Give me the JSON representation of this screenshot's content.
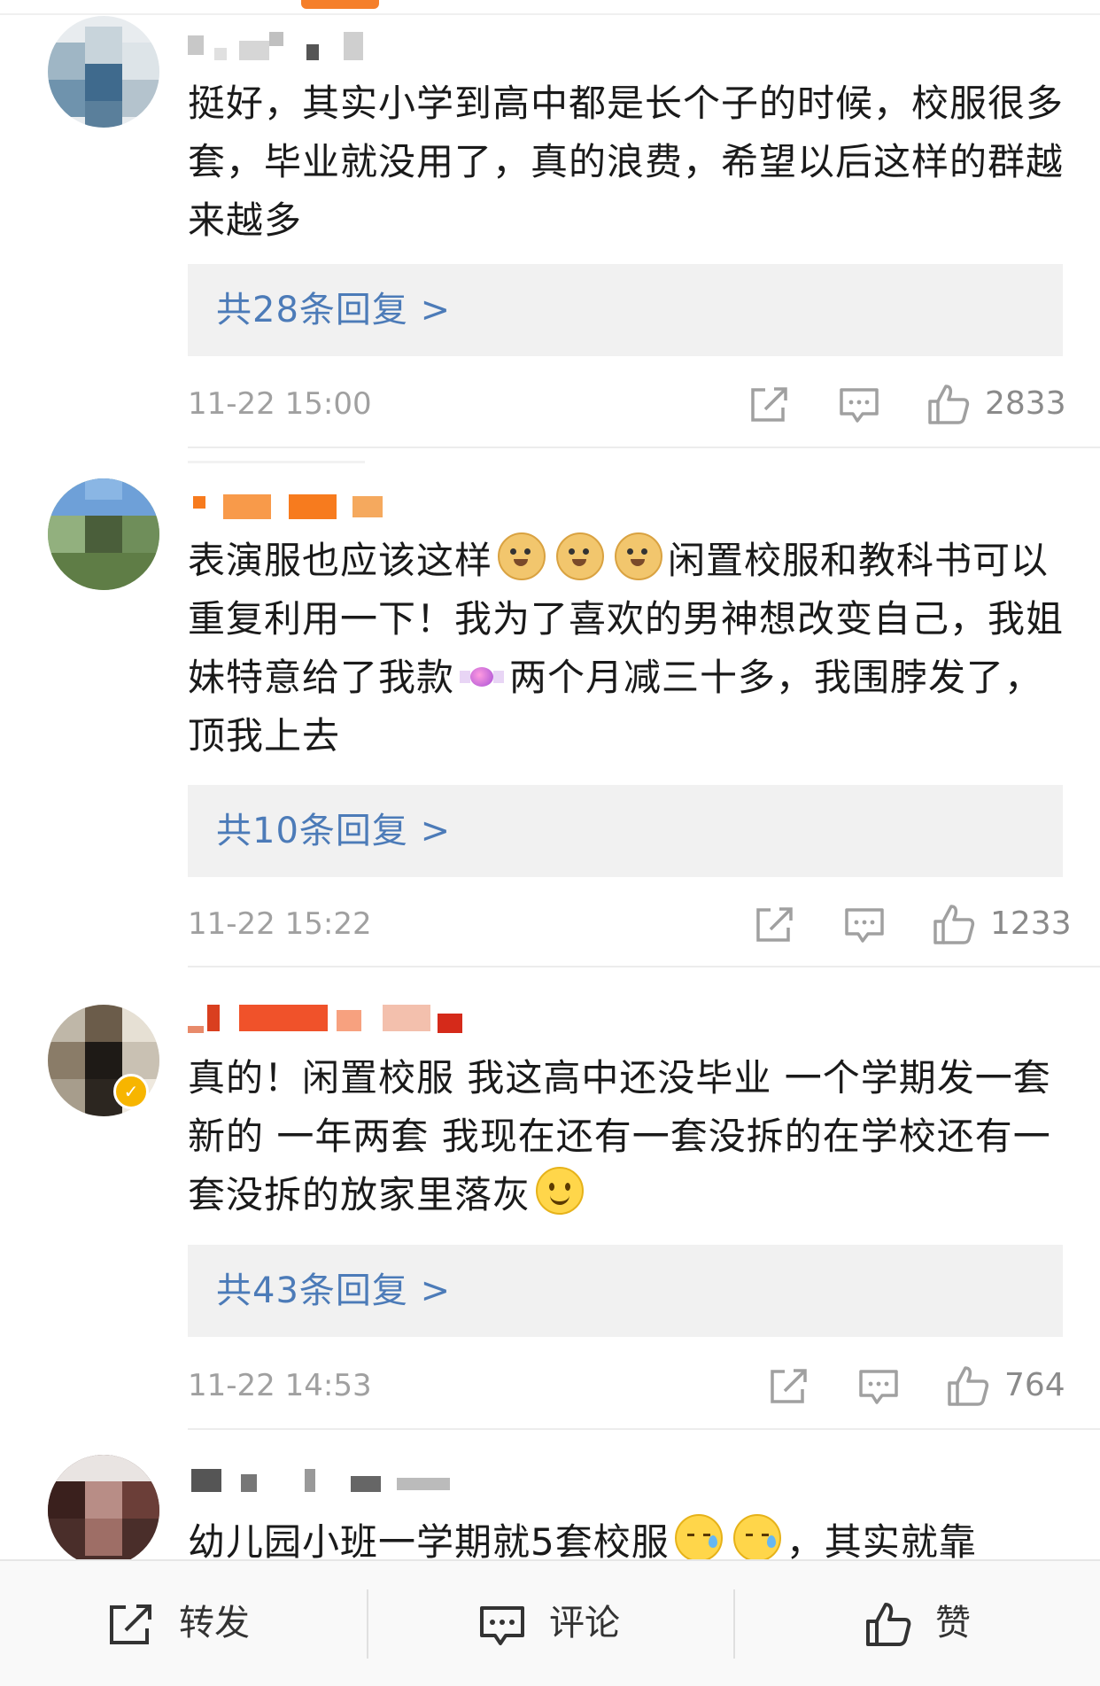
{
  "comments": [
    {
      "text": "挺好，其实小学到高中都是长个子的时候，校服很多套，毕业就没用了，真的浪费，希望以后这样的群越来越多",
      "replies_label": "共28条回复 >",
      "time": "11-22 15:00",
      "likes": "2833"
    },
    {
      "text_a": "表演服也应该这样",
      "text_b": "闲置校服和教科书可以重复利用一下！我为了喜欢的男神想改变自己，我姐妹特意给了我款",
      "text_c": "两个月减三十多，我围脖发了，顶我上去",
      "emojis": [
        "doge-emoji",
        "doge-emoji",
        "doge-emoji",
        "candy-emoji"
      ],
      "replies_label": "共10条回复 >",
      "time": "11-22 15:22",
      "likes": "1233"
    },
    {
      "text": "真的！闲置校服 我这高中还没毕业 一个学期发一套新的 一年两套 我现在还有一套没拆的在学校还有一套没拆的放家里落灰",
      "emojis": [
        "smile-emoji"
      ],
      "verified": true,
      "replies_label": "共43条回复 >",
      "time": "11-22 14:53",
      "likes": "764"
    },
    {
      "text_a": "幼儿园小班一学期就5套校服",
      "text_b": "，其实就靠",
      "emojis": [
        "sweat-emoji",
        "sweat-emoji"
      ]
    }
  ],
  "bottom_bar": {
    "repost_label": "转发",
    "comment_label": "评论",
    "like_label": "赞"
  },
  "colors": {
    "accent": "#f57f2a",
    "link": "#4c7bb8",
    "reply_bg": "#f1f1f1",
    "meta_text": "#a0a0a0",
    "verified": "#f7b500"
  }
}
